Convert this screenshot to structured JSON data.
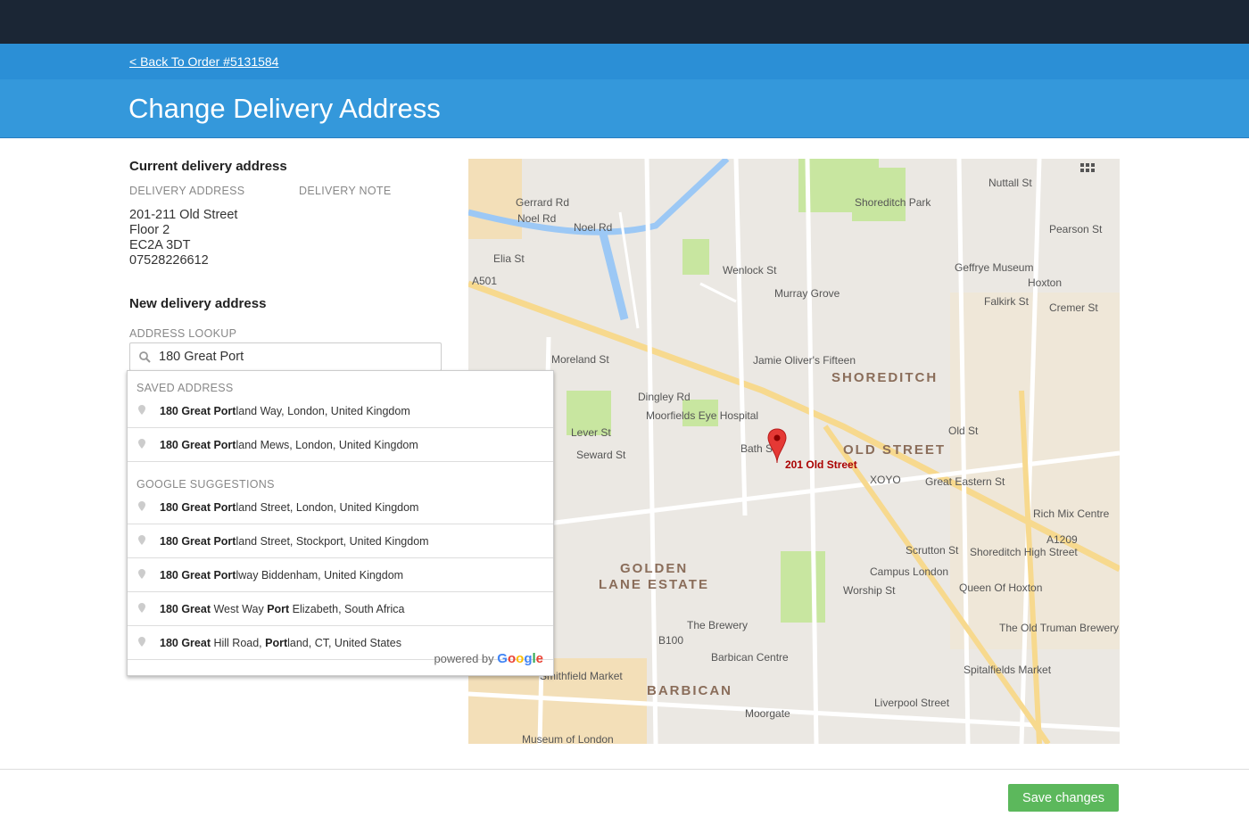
{
  "header": {
    "back_link": "< Back To Order #5131584",
    "title": "Change Delivery Address"
  },
  "current": {
    "heading": "Current delivery address",
    "address_label": "DELIVERY ADDRESS",
    "note_label": "DELIVERY NOTE",
    "address_lines": [
      "201-211 Old Street",
      "Floor 2",
      "EC2A 3DT",
      "07528226612"
    ]
  },
  "new": {
    "heading": "New delivery address",
    "lookup_label": "ADDRESS LOOKUP",
    "lookup_value": "180 Great Port",
    "search_icon": "search-icon"
  },
  "dropdown": {
    "saved_label": "SAVED ADDRESS",
    "saved": [
      {
        "parts": [
          {
            "b": true,
            "t": "180 Great Port"
          },
          {
            "b": false,
            "t": "land Way, London, United Kingdom"
          }
        ]
      },
      {
        "parts": [
          {
            "b": true,
            "t": "180 Great Port"
          },
          {
            "b": false,
            "t": "land Mews, London, United Kingdom"
          }
        ]
      }
    ],
    "google_label": "GOOGLE SUGGESTIONS",
    "google": [
      {
        "parts": [
          {
            "b": true,
            "t": "180 Great Port"
          },
          {
            "b": false,
            "t": "land Street, London, United Kingdom"
          }
        ]
      },
      {
        "parts": [
          {
            "b": true,
            "t": "180 Great Port"
          },
          {
            "b": false,
            "t": "land Street, Stockport, United Kingdom"
          }
        ]
      },
      {
        "parts": [
          {
            "b": true,
            "t": "180 Great Port"
          },
          {
            "b": false,
            "t": "lway Biddenham, United Kingdom"
          }
        ]
      },
      {
        "parts": [
          {
            "b": true,
            "t": "180 Great"
          },
          {
            "b": false,
            "t": " West Way "
          },
          {
            "b": true,
            "t": "Port"
          },
          {
            "b": false,
            "t": " Elizabeth, South Africa"
          }
        ]
      },
      {
        "parts": [
          {
            "b": true,
            "t": "180 Great"
          },
          {
            "b": false,
            "t": " Hill Road, "
          },
          {
            "b": true,
            "t": "Port"
          },
          {
            "b": false,
            "t": "land, CT, United States"
          }
        ]
      }
    ],
    "powered_by": "powered by",
    "google_logo": "Google"
  },
  "map": {
    "marker_label": "201 Old Street",
    "areas": [
      "SHOREDITCH",
      "OLD STREET",
      "GOLDEN",
      "LANE ESTATE",
      "BARBICAN"
    ],
    "labels": [
      "Gerrard Rd",
      "Noel Rd",
      "Noel Rd",
      "Elia St",
      "A501",
      "Wenlock St",
      "Murray Grove",
      "Shoreditch Park",
      "Geffrye Museum",
      "Hoxton",
      "Pearson St",
      "Falkirk St",
      "Cremer St",
      "Jamie Oliver's Fifteen",
      "Moorfields Eye Hospital",
      "Dingley Rd",
      "Moreland St",
      "Lever St",
      "Seward St",
      "XOYO",
      "Great Eastern St",
      "Rich Mix Centre",
      "Shoreditch High Street",
      "Scrutton St",
      "Campus London",
      "Worship St",
      "Queen Of Hoxton",
      "The Old Truman Brewery",
      "The Brewery",
      "Barbican Centre",
      "Smithfield Market",
      "Spitalfields Market",
      "Liverpool Street",
      "Moorgate",
      "Museum of London",
      "Old St",
      "Bath St",
      "B100",
      "A1209",
      "Nuttall St"
    ]
  },
  "footer": {
    "save_label": "Save changes"
  },
  "colors": {
    "topbar": "#1b2635",
    "header": "#3498db",
    "save": "#5cb85c",
    "marker": "#e53935"
  }
}
